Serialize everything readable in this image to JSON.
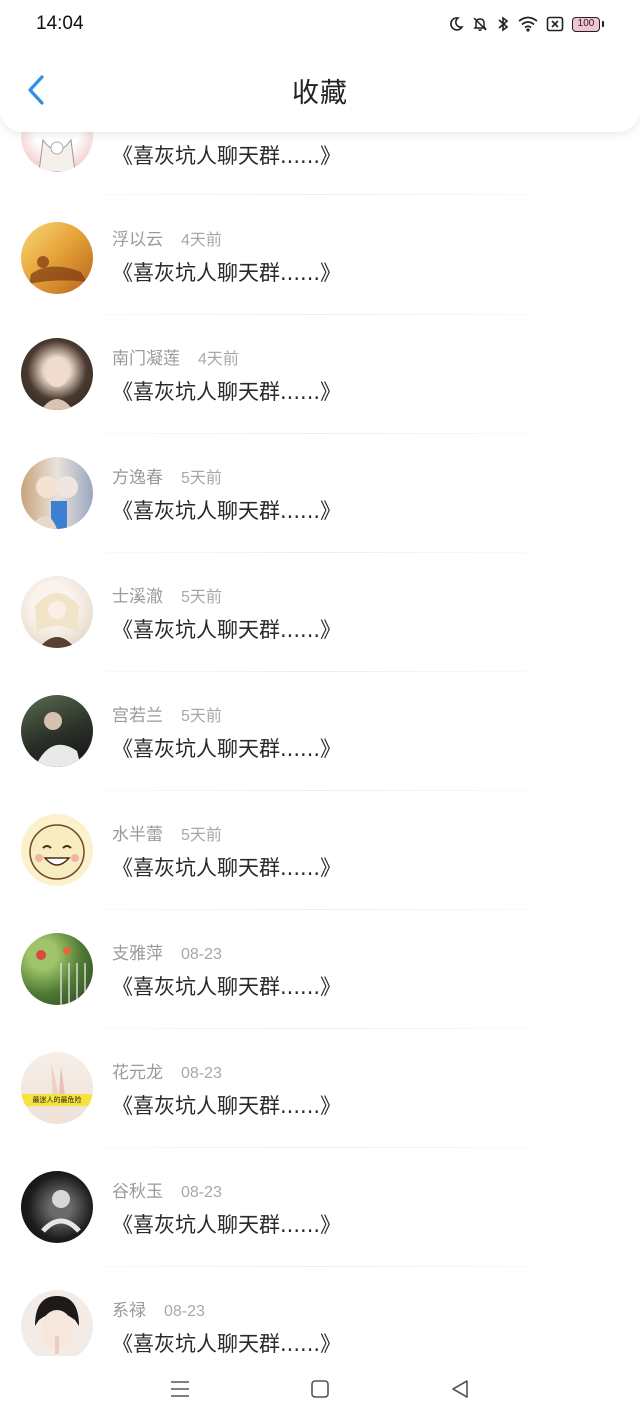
{
  "status_bar": {
    "time": "14:04",
    "battery": "100"
  },
  "header": {
    "title": "收藏"
  },
  "first_partial": {
    "content": "《喜灰坑人聊天群......》"
  },
  "items": [
    {
      "name": "浮以云",
      "time": "4天前",
      "content": "《喜灰坑人聊天群......》"
    },
    {
      "name": "南门凝莲",
      "time": "4天前",
      "content": "《喜灰坑人聊天群......》"
    },
    {
      "name": "方逸春",
      "time": "5天前",
      "content": "《喜灰坑人聊天群......》"
    },
    {
      "name": "士溪澈",
      "time": "5天前",
      "content": "《喜灰坑人聊天群......》"
    },
    {
      "name": "宫若兰",
      "time": "5天前",
      "content": "《喜灰坑人聊天群......》"
    },
    {
      "name": "水半蕾",
      "time": "5天前",
      "content": "《喜灰坑人聊天群......》"
    },
    {
      "name": "支雅萍",
      "time": "08-23",
      "content": "《喜灰坑人聊天群......》"
    },
    {
      "name": "花元龙",
      "time": "08-23",
      "content": "《喜灰坑人聊天群......》",
      "avatar_text": "最迷人的最危险"
    },
    {
      "name": "谷秋玉",
      "time": "08-23",
      "content": "《喜灰坑人聊天群......》"
    },
    {
      "name": "系禄",
      "time": "08-23",
      "content": "《喜灰坑人聊天群......》"
    }
  ],
  "colors": {
    "accent": "#2f8fe6",
    "text": "#2a2a2a",
    "meta": "#9a9a9a"
  }
}
